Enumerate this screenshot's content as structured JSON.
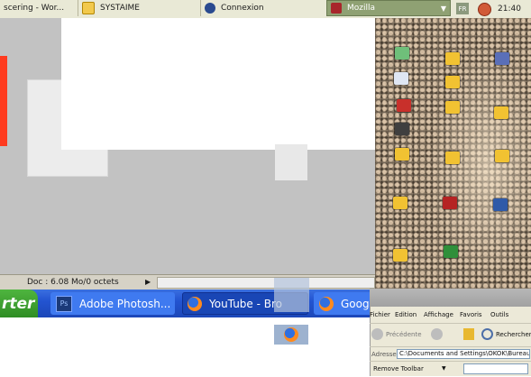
{
  "top_taskbar": {
    "tasks": [
      {
        "label": "scering - Wor..."
      },
      {
        "label": "SYSTAIME"
      },
      {
        "label": "Connexion"
      },
      {
        "label": "Mozilla"
      }
    ],
    "language": "FR",
    "clock": "21:40"
  },
  "photoshop": {
    "status_text": "Doc : 6.08 Mo/0 octets",
    "play_glyph": "▶"
  },
  "taskbar": {
    "start_label": "rter",
    "buttons": [
      {
        "label": "Adobe Photosh...",
        "icon": "photoshop-icon",
        "icon_text": "Ps"
      },
      {
        "label": "YouTube - Bro",
        "icon": "firefox-icon"
      },
      {
        "label": "Goog",
        "icon": "firefox-icon"
      }
    ]
  },
  "explorer": {
    "menu": [
      "Fichier",
      "Edition",
      "Affichage",
      "Favoris",
      "Outils"
    ],
    "toolbar": {
      "back": "Précédente",
      "search": "Rechercher"
    },
    "address_label": "Adresse",
    "address": "C:\\Documents and Settings\\OKOK\\Bureau\\m",
    "links": "Remove Toolbar"
  },
  "colors": {
    "taskbar_blue": "#2354d1",
    "start_green": "#3a9d2d",
    "top_bar": "#e9e9d6",
    "mozilla_active": "#8fa173"
  }
}
